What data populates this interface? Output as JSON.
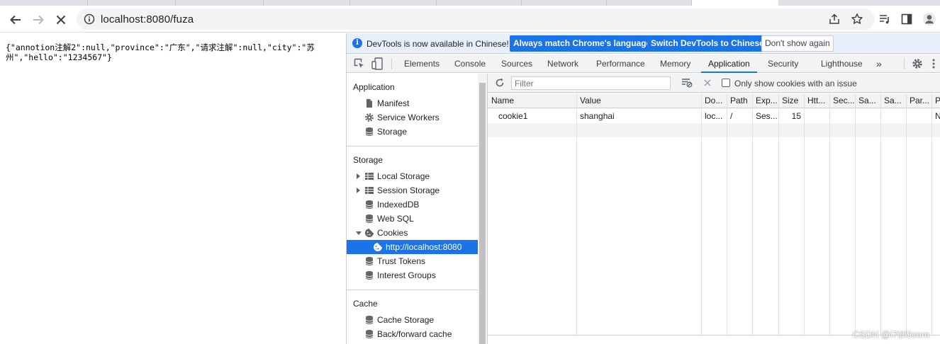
{
  "browser": {
    "url": "localhost:8080/fuza"
  },
  "page": {
    "json_text": "{\"annotion注解2\":null,\"province\":\"广东\",\"请求注解\":null,\"city\":\"苏州\",\"hello\":\"1234567\"}"
  },
  "devtools": {
    "infobar": {
      "message": "DevTools is now available in Chinese!",
      "match_button": "Always match Chrome's language",
      "switch_button": "Switch DevTools to Chinese",
      "dismiss_button": "Don't show again"
    },
    "tabs": [
      "Elements",
      "Console",
      "Sources",
      "Network",
      "Performance",
      "Memory",
      "Application",
      "Security",
      "Lighthouse"
    ],
    "active_tab": "Application",
    "more_tabs": "»",
    "sidebar": {
      "application_heading": "Application",
      "application_items": [
        "Manifest",
        "Service Workers",
        "Storage"
      ],
      "storage_heading": "Storage",
      "storage_items": [
        "Local Storage",
        "Session Storage",
        "IndexedDB",
        "Web SQL",
        "Cookies",
        "http://localhost:8080",
        "Trust Tokens",
        "Interest Groups"
      ],
      "cache_heading": "Cache",
      "cache_items": [
        "Cache Storage",
        "Back/forward cache"
      ]
    },
    "cookies": {
      "filter_placeholder": "Filter",
      "issue_checkbox_label": "Only show cookies with an issue",
      "columns": [
        "Name",
        "Value",
        "Do...",
        "Path",
        "Exp...",
        "Size",
        "Htt...",
        "Sec...",
        "Sa...",
        "Sa...",
        "Par...",
        "P"
      ],
      "rows": [
        {
          "name": "cookie1",
          "value": "shanghai",
          "domain": "loc...",
          "path": "/",
          "expires": "Ses...",
          "size": "15",
          "partition_key": "N"
        }
      ]
    }
  },
  "watermark": "CSDN @i7i8i9com",
  "colors": {
    "accent": "#1a73e8",
    "toolbar_bg": "#f1f3f4",
    "infobar_bg": "#e8f0fe"
  }
}
